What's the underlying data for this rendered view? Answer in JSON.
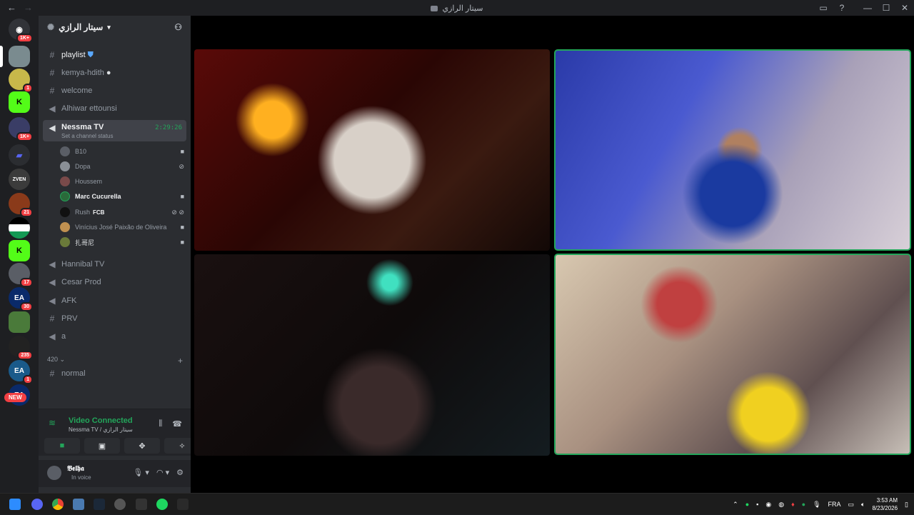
{
  "window": {
    "title": "سيتار الرازي",
    "controls": [
      "minimize",
      "maximize",
      "close"
    ]
  },
  "guild": {
    "name": "سيتار الرازي",
    "channels": [
      {
        "type": "text",
        "name": "playlist",
        "emoji": "shield-blue"
      },
      {
        "type": "text",
        "name": "kemya-hdith",
        "emoji": "speech-bubble"
      },
      {
        "type": "text",
        "name": "welcome"
      },
      {
        "type": "voice",
        "name": "Alhiwar ettounsi"
      },
      {
        "type": "voice",
        "name": "Nessma TV",
        "active": true,
        "timer": "2:29:26",
        "status_hint": "Set a channel status"
      },
      {
        "type": "voice",
        "name": "Hannibal TV"
      },
      {
        "type": "voice",
        "name": "Cesar Prod"
      },
      {
        "type": "voice",
        "name": "AFK"
      },
      {
        "type": "text",
        "name": "PRV"
      },
      {
        "type": "voice",
        "name": "a"
      }
    ],
    "voice_users": [
      {
        "name": "B10",
        "indicator": "video-icon"
      },
      {
        "name": "Dopa",
        "indicator": "mic-muted-icon"
      },
      {
        "name": "Houssem",
        "indicator": ""
      },
      {
        "name": "Marc Cucurella",
        "indicator": "video-icon",
        "bold": true
      },
      {
        "name": "Rush",
        "tag": "FCB",
        "indicator": "deafened-icon"
      },
      {
        "name": "Vinícius José Paixão de Oliveira",
        "indicator": "video-icon"
      },
      {
        "name": "扎哥尼",
        "indicator": "video-icon"
      }
    ],
    "category": {
      "name": "420",
      "channels": [
        {
          "type": "text",
          "name": "normal"
        }
      ]
    }
  },
  "server_badges": {
    "top": "1K+",
    "s1": "1",
    "s2": "1K+",
    "s3": "21",
    "s4": "17",
    "s5": "30",
    "s6": "235",
    "s7": "1",
    "new": "NEW"
  },
  "voice_panel": {
    "title": "Video Connected",
    "subtitle": "Nessma TV / سيتار الرازي"
  },
  "user_panel": {
    "name": "𝕭𝖊𝖑𝖍𝖆",
    "status": "In voice"
  },
  "taskbar": {
    "language": "FRA",
    "time": "3:53 AM",
    "date": "8/23/2026"
  },
  "colors": {
    "bg": "#1e1f22",
    "sidebar": "#2b2d31",
    "accent_green": "#23a55a",
    "danger": "#f23f43"
  }
}
